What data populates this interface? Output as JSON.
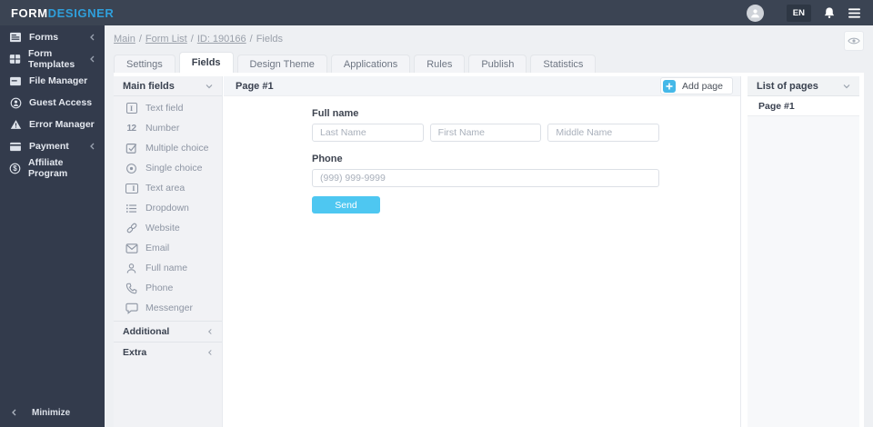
{
  "topbar": {
    "logo_part1": "FORM",
    "logo_part2": "DESIGNER",
    "language": "EN"
  },
  "sidebar": {
    "items": [
      {
        "label": "Forms",
        "icon": "forms-icon",
        "collapsible": true
      },
      {
        "label": "Form Templates",
        "icon": "form-templates-icon",
        "collapsible": true
      },
      {
        "label": "File Manager",
        "icon": "file-manager-icon",
        "collapsible": false
      },
      {
        "label": "Guest Access",
        "icon": "guest-access-icon",
        "collapsible": false
      },
      {
        "label": "Error Manager",
        "icon": "error-manager-icon",
        "collapsible": false
      },
      {
        "label": "Payment",
        "icon": "payment-icon",
        "collapsible": true
      },
      {
        "label": "Affiliate Program",
        "icon": "affiliate-program-icon",
        "collapsible": false
      }
    ],
    "minimize_label": "Minimize"
  },
  "breadcrumb": {
    "separator": "/",
    "items": [
      {
        "label": "Main",
        "link": true
      },
      {
        "label": "Form List",
        "link": true
      },
      {
        "label": "ID: 190166",
        "link": true
      },
      {
        "label": "Fields",
        "link": false
      }
    ]
  },
  "tabs": [
    {
      "label": "Settings",
      "active": false
    },
    {
      "label": "Fields",
      "active": true
    },
    {
      "label": "Design Theme",
      "active": false
    },
    {
      "label": "Applications",
      "active": false
    },
    {
      "label": "Rules",
      "active": false
    },
    {
      "label": "Publish",
      "active": false
    },
    {
      "label": "Statistics",
      "active": false
    }
  ],
  "fields_panel": {
    "header": "Main fields",
    "glyphs": {
      "text_field": "I",
      "number": "12",
      "text_area": "I",
      "dollar": "$"
    },
    "items": [
      {
        "label": "Text field",
        "icon": "text-field-icon"
      },
      {
        "label": "Number",
        "icon": "number-icon"
      },
      {
        "label": "Multiple choice",
        "icon": "multiple-choice-icon"
      },
      {
        "label": "Single choice",
        "icon": "single-choice-icon"
      },
      {
        "label": "Text area",
        "icon": "text-area-icon"
      },
      {
        "label": "Dropdown",
        "icon": "dropdown-icon"
      },
      {
        "label": "Website",
        "icon": "website-icon"
      },
      {
        "label": "Email",
        "icon": "email-icon"
      },
      {
        "label": "Full name",
        "icon": "full-name-icon"
      },
      {
        "label": "Phone",
        "icon": "phone-icon"
      },
      {
        "label": "Messenger",
        "icon": "messenger-icon"
      }
    ],
    "sections": [
      {
        "label": "Additional"
      },
      {
        "label": "Extra"
      }
    ]
  },
  "canvas": {
    "page_title": "Page #1",
    "add_page_label": "Add page",
    "form": {
      "fullname_label": "Full name",
      "fullname_placeholders": [
        "Last Name",
        "First Name",
        "Middle Name"
      ],
      "phone_label": "Phone",
      "phone_placeholder": "(999) 999-9999",
      "send_label": "Send"
    }
  },
  "pages_panel": {
    "header": "List of pages",
    "pages": [
      "Page #1"
    ]
  },
  "colors": {
    "accent_blue": "#4ec7f1",
    "logo_blue": "#2f9fdb",
    "topbar_bg": "#3b4453",
    "sidebar_bg": "#333b4c"
  }
}
